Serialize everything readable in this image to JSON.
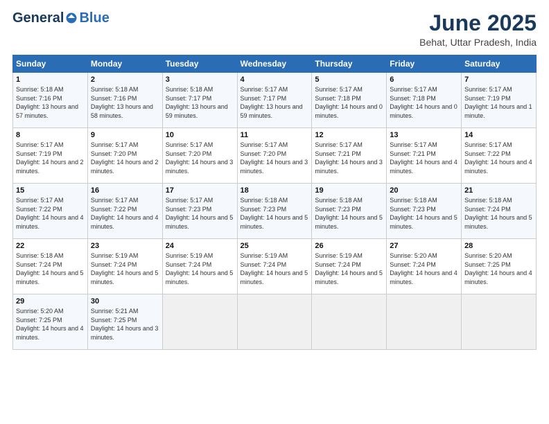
{
  "header": {
    "logo_general": "General",
    "logo_blue": "Blue",
    "month_title": "June 2025",
    "location": "Behat, Uttar Pradesh, India"
  },
  "calendar": {
    "days_of_week": [
      "Sunday",
      "Monday",
      "Tuesday",
      "Wednesday",
      "Thursday",
      "Friday",
      "Saturday"
    ],
    "weeks": [
      [
        null,
        {
          "day": 2,
          "sunrise": "5:18 AM",
          "sunset": "7:16 PM",
          "daylight": "13 hours and 58 minutes."
        },
        {
          "day": 3,
          "sunrise": "5:18 AM",
          "sunset": "7:17 PM",
          "daylight": "13 hours and 59 minutes."
        },
        {
          "day": 4,
          "sunrise": "5:17 AM",
          "sunset": "7:17 PM",
          "daylight": "13 hours and 59 minutes."
        },
        {
          "day": 5,
          "sunrise": "5:17 AM",
          "sunset": "7:18 PM",
          "daylight": "14 hours and 0 minutes."
        },
        {
          "day": 6,
          "sunrise": "5:17 AM",
          "sunset": "7:18 PM",
          "daylight": "14 hours and 0 minutes."
        },
        {
          "day": 7,
          "sunrise": "5:17 AM",
          "sunset": "7:19 PM",
          "daylight": "14 hours and 1 minute."
        }
      ],
      [
        {
          "day": 1,
          "sunrise": "5:18 AM",
          "sunset": "7:16 PM",
          "daylight": "13 hours and 57 minutes."
        },
        {
          "day": 8,
          "sunrise": "5:17 AM",
          "sunset": "7:19 PM",
          "daylight": "14 hours and 2 minutes."
        },
        {
          "day": 9,
          "sunrise": "5:17 AM",
          "sunset": "7:20 PM",
          "daylight": "14 hours and 2 minutes."
        },
        {
          "day": 10,
          "sunrise": "5:17 AM",
          "sunset": "7:20 PM",
          "daylight": "14 hours and 3 minutes."
        },
        {
          "day": 11,
          "sunrise": "5:17 AM",
          "sunset": "7:20 PM",
          "daylight": "14 hours and 3 minutes."
        },
        {
          "day": 12,
          "sunrise": "5:17 AM",
          "sunset": "7:21 PM",
          "daylight": "14 hours and 3 minutes."
        },
        {
          "day": 13,
          "sunrise": "5:17 AM",
          "sunset": "7:21 PM",
          "daylight": "14 hours and 4 minutes."
        },
        {
          "day": 14,
          "sunrise": "5:17 AM",
          "sunset": "7:22 PM",
          "daylight": "14 hours and 4 minutes."
        }
      ],
      [
        {
          "day": 15,
          "sunrise": "5:17 AM",
          "sunset": "7:22 PM",
          "daylight": "14 hours and 4 minutes."
        },
        {
          "day": 16,
          "sunrise": "5:17 AM",
          "sunset": "7:22 PM",
          "daylight": "14 hours and 4 minutes."
        },
        {
          "day": 17,
          "sunrise": "5:17 AM",
          "sunset": "7:23 PM",
          "daylight": "14 hours and 5 minutes."
        },
        {
          "day": 18,
          "sunrise": "5:18 AM",
          "sunset": "7:23 PM",
          "daylight": "14 hours and 5 minutes."
        },
        {
          "day": 19,
          "sunrise": "5:18 AM",
          "sunset": "7:23 PM",
          "daylight": "14 hours and 5 minutes."
        },
        {
          "day": 20,
          "sunrise": "5:18 AM",
          "sunset": "7:23 PM",
          "daylight": "14 hours and 5 minutes."
        },
        {
          "day": 21,
          "sunrise": "5:18 AM",
          "sunset": "7:24 PM",
          "daylight": "14 hours and 5 minutes."
        }
      ],
      [
        {
          "day": 22,
          "sunrise": "5:18 AM",
          "sunset": "7:24 PM",
          "daylight": "14 hours and 5 minutes."
        },
        {
          "day": 23,
          "sunrise": "5:19 AM",
          "sunset": "7:24 PM",
          "daylight": "14 hours and 5 minutes."
        },
        {
          "day": 24,
          "sunrise": "5:19 AM",
          "sunset": "7:24 PM",
          "daylight": "14 hours and 5 minutes."
        },
        {
          "day": 25,
          "sunrise": "5:19 AM",
          "sunset": "7:24 PM",
          "daylight": "14 hours and 5 minutes."
        },
        {
          "day": 26,
          "sunrise": "5:19 AM",
          "sunset": "7:24 PM",
          "daylight": "14 hours and 5 minutes."
        },
        {
          "day": 27,
          "sunrise": "5:20 AM",
          "sunset": "7:24 PM",
          "daylight": "14 hours and 4 minutes."
        },
        {
          "day": 28,
          "sunrise": "5:20 AM",
          "sunset": "7:25 PM",
          "daylight": "14 hours and 4 minutes."
        }
      ],
      [
        {
          "day": 29,
          "sunrise": "5:20 AM",
          "sunset": "7:25 PM",
          "daylight": "14 hours and 4 minutes."
        },
        {
          "day": 30,
          "sunrise": "5:21 AM",
          "sunset": "7:25 PM",
          "daylight": "14 hours and 3 minutes."
        },
        null,
        null,
        null,
        null,
        null
      ]
    ]
  }
}
